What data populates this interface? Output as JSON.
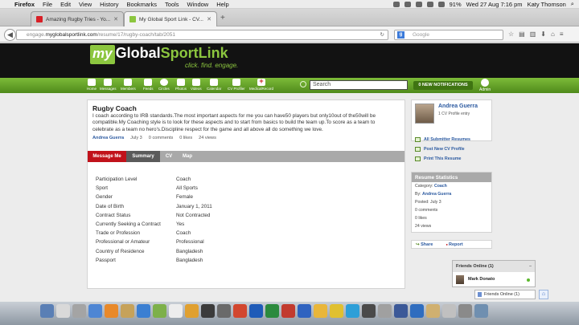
{
  "os_menubar": {
    "app": "Firefox",
    "menus": [
      "File",
      "Edit",
      "View",
      "History",
      "Bookmarks",
      "Tools",
      "Window",
      "Help"
    ],
    "battery": "91%",
    "clock": "Wed 27 Aug  7:16 pm",
    "user": "Katy Thomson"
  },
  "browser": {
    "tabs": [
      {
        "title": "Amazing Rugby Tries - Yo...",
        "favicon_color": "#d81f26"
      },
      {
        "title": "My Global Sport Link - CV...",
        "favicon_color": "#8cc63f"
      }
    ],
    "new_tab": "+",
    "url_prefix": "engage.",
    "url_domain": "myglobalsportlink.com",
    "url_path": "/resume/17/rugby-coach/tab/2051",
    "search_placeholder": "Google",
    "search_engine_letter": "g"
  },
  "site": {
    "logo_my": "my",
    "logo_global": "Global",
    "logo_sport": "SportLink",
    "tagline": "click. find. engage.",
    "nav": [
      {
        "label": "Home",
        "icon": "home-icon"
      },
      {
        "label": "Messages",
        "icon": "messages-icon"
      },
      {
        "label": "Members",
        "icon": "members-icon"
      },
      {
        "label": "Feeds",
        "icon": "feeds-icon"
      },
      {
        "label": "Circles",
        "icon": "circles-icon"
      },
      {
        "label": "Photos",
        "icon": "photos-icon"
      },
      {
        "label": "Videos",
        "icon": "videos-icon"
      },
      {
        "label": "Calendar",
        "icon": "calendar-icon"
      },
      {
        "label": "CV Profiler",
        "icon": "cv-profiler-icon"
      },
      {
        "label": "MedicalRecord",
        "icon": "medical-record-icon"
      }
    ],
    "search_placeholder": "Search",
    "notifications": "0 NEW NOTIFICATIONS",
    "admin_label": "Admin"
  },
  "resume": {
    "title": "Rugby Coach",
    "description": "I coach according to IRB standards.The most important aspects for me you can have50 players but only10out of the50will be compatible.My Coaching style is to look for these aspects and to start from basics to build the team up.To score as a team to celebrate as a team no hero's.Discipline respect for the game and all above all do something we love.",
    "author": "Andrea Guerra",
    "date": "July 3",
    "comments": "0 comments",
    "likes": "0 likes",
    "views": "24 views",
    "tabs": [
      "Message Me",
      "Summary",
      "CV",
      "Map"
    ],
    "details": [
      {
        "label": "Participation Level",
        "value": "Coach"
      },
      {
        "label": "Sport",
        "value": "All Sports"
      },
      {
        "label": "Gender",
        "value": "Female"
      },
      {
        "label": "Date of Birth",
        "value": "January 1, 2011"
      },
      {
        "label": "Contract Status",
        "value": "Not Contracted"
      },
      {
        "label": "Currently Seeking a Contract",
        "value": "Yes"
      },
      {
        "label": "Trade or Profession",
        "value": "Coach"
      },
      {
        "label": "Professional or Amateur",
        "value": "Professional"
      },
      {
        "label": "Country of Residence",
        "value": "Bangladesh"
      },
      {
        "label": "Passport",
        "value": "Bangladesh"
      }
    ]
  },
  "sidebar": {
    "profile_name": "Andrea Guerra",
    "profile_count": "1 CV Profile entry",
    "actions": [
      "All Submitter Resumes",
      "Post New CV Profile",
      "Print This Resume"
    ],
    "stats_title": "Resume Statistics",
    "category_label": "Category:",
    "category_value": "Coach",
    "by_label": "By:",
    "by_value": "Andrea Guerra",
    "posted": "Posted: July 3",
    "comments": "0 comments",
    "likes": "0 likes",
    "views": "24 views",
    "share": "Share",
    "report": "Report"
  },
  "friends": {
    "header": "Friends Online (1)",
    "minimize": "–",
    "friend_name": "Mark Donato",
    "button": "Friends Online (1)"
  },
  "dock_colors": [
    "#5a7fb5",
    "#d9d9d9",
    "#a4a4a4",
    "#4e86d4",
    "#e8892a",
    "#c6a25a",
    "#3b7fd2",
    "#7db04a",
    "#ededed",
    "#e0a030",
    "#3b3b3b",
    "#6a6a6a",
    "#d2472f",
    "#1e5bb8",
    "#2b8a3e",
    "#c23b2f",
    "#2f63c0",
    "#e9b63a",
    "#e0c030",
    "#2d9fd8",
    "#4a4a4a",
    "#a0a0a0",
    "#3b5998",
    "#2f6dbf",
    "#d0b070",
    "#c0c0c0",
    "#8a8a8a",
    "#6f8fb0"
  ]
}
